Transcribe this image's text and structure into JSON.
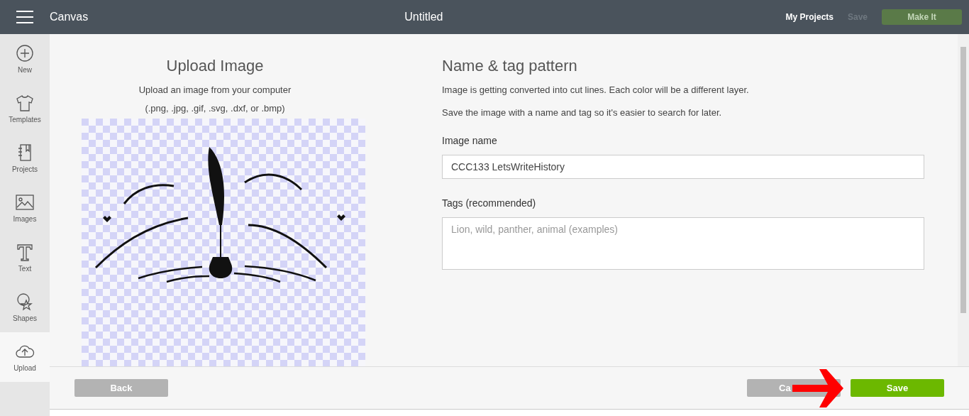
{
  "header": {
    "title": "Canvas",
    "document": "Untitled",
    "links": [
      {
        "label": "My Projects",
        "disabled": false
      },
      {
        "label": "Save",
        "disabled": true
      }
    ],
    "make_it": {
      "label": "Make It",
      "disabled": true
    }
  },
  "sidebar": {
    "items": [
      {
        "label": "New",
        "selected": false
      },
      {
        "label": "Templates",
        "selected": false
      },
      {
        "label": "Projects",
        "selected": false
      },
      {
        "label": "Images",
        "selected": false
      },
      {
        "label": "Text",
        "selected": false
      },
      {
        "label": "Shapes",
        "selected": false
      },
      {
        "label": "Upload",
        "selected": true
      }
    ]
  },
  "upload": {
    "title": "Upload Image",
    "lines": [
      "Upload an image from your computer",
      "(.png, .jpg, .gif, .svg, .dxf, or .bmp)"
    ]
  },
  "form": {
    "title": "Name & tag pattern",
    "notes": [
      "Image is getting converted into cut lines. Each color will be a different layer.",
      "Save the image with a name and tag so it's easier to search for later."
    ],
    "name_label": "Image name",
    "name_value": "CCC133 LetsWriteHistory",
    "tags_label": "Tags (recommended)",
    "tags_placeholder": "Lion, wild, panther, animal (examples)"
  },
  "footer": {
    "back": "Back",
    "cancel": "Ca",
    "save": "Save"
  }
}
